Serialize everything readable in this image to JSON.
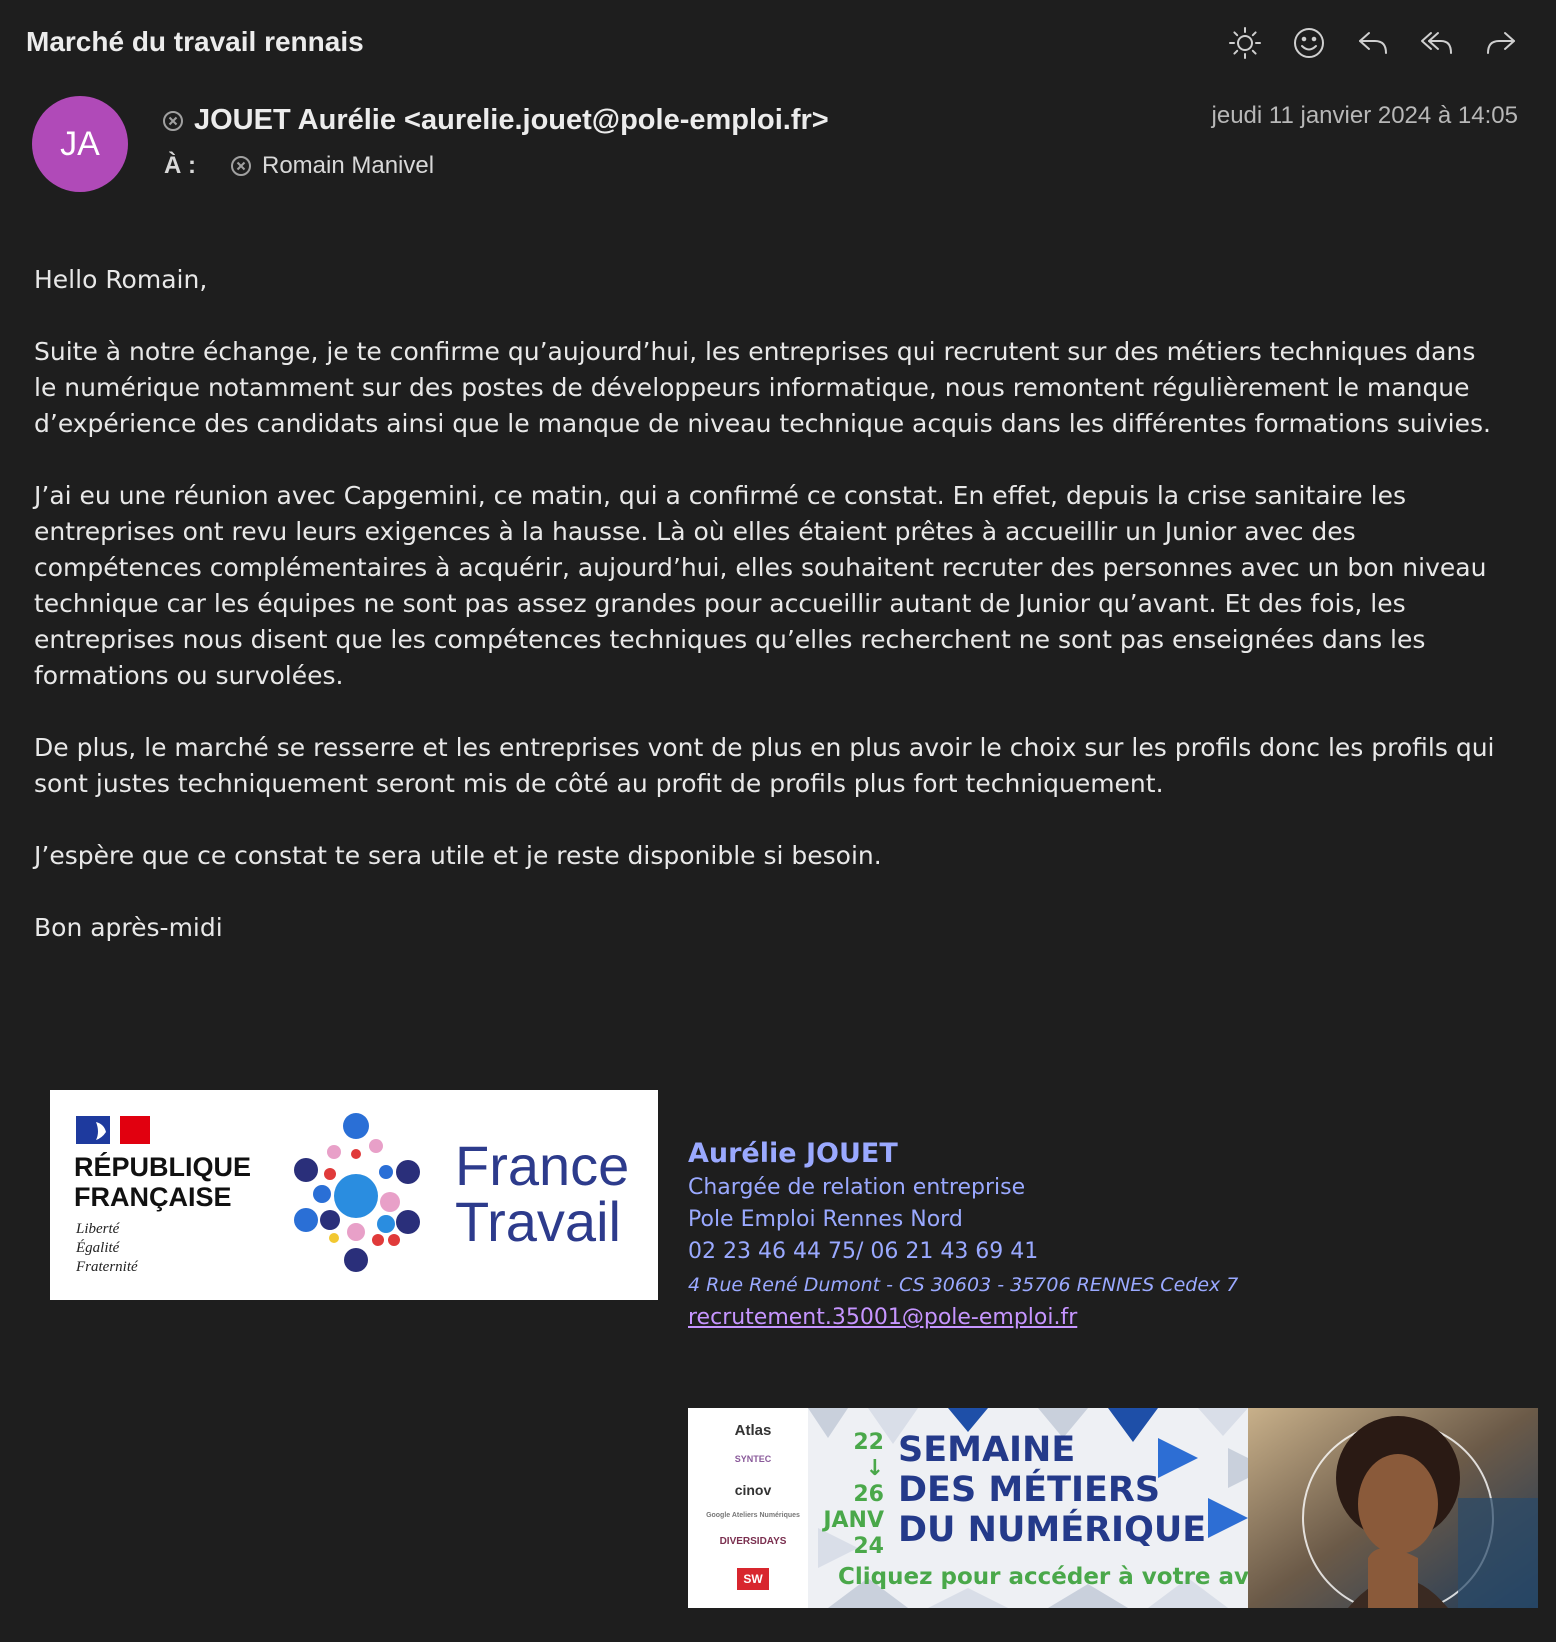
{
  "header": {
    "subject": "Marché du travail rennais",
    "toolbar": [
      {
        "name": "appearance-icon"
      },
      {
        "name": "emoji-icon"
      },
      {
        "name": "reply-icon"
      },
      {
        "name": "reply-all-icon"
      },
      {
        "name": "forward-icon"
      }
    ]
  },
  "message": {
    "avatar_initials": "JA",
    "avatar_color": "#b04ab8",
    "from": "JOUET Aurélie <aurelie.jouet@pole-emploi.fr>",
    "to_label": "À :",
    "to": "Romain Manivel",
    "date": "jeudi 11 janvier 2024 à 14:05"
  },
  "body": {
    "greeting": "Hello Romain,",
    "paragraphs": [
      "Suite à notre échange, je te confirme qu’aujourd’hui, les entreprises qui recrutent sur des métiers techniques dans le numérique notamment sur des postes de développeurs informatique, nous remontent régulièrement le manque d’expérience des candidats ainsi que le manque de niveau technique acquis dans les différentes formations suivies.",
      "J’ai eu une réunion avec Capgemini, ce matin, qui a confirmé ce constat. En effet, depuis la crise sanitaire les entreprises ont revu leurs exigences à la hausse. Là où elles étaient prêtes à accueillir un Junior avec des compétences complémentaires à acquérir, aujourd’hui, elles souhaitent recruter des personnes avec un bon niveau technique car les équipes ne sont pas assez grandes pour accueillir autant de Junior qu’avant. Et des fois, les entreprises nous disent que les compétences techniques qu’elles recherchent ne sont pas enseignées dans les formations ou survolées.",
      "De plus, le marché se resserre et les entreprises vont de plus en plus avoir le choix sur les profils donc les profils qui sont justes techniquement seront mis de côté au profit de profils plus fort techniquement.",
      "J’espère que ce constat te sera utile et je reste disponible si besoin.",
      "Bon après-midi"
    ]
  },
  "logo": {
    "rf_line1": "RÉPUBLIQUE",
    "rf_line2": "FRANÇAISE",
    "motto": [
      "Liberté",
      "Égalité",
      "Fraternité"
    ],
    "ft_line1": "France",
    "ft_line2": "Travail"
  },
  "signature": {
    "name": "Aurélie JOUET",
    "role": "Chargée de relation entreprise",
    "agency": "Pole Emploi Rennes Nord",
    "phones": "02 23 46 44 75/ 06 21 43 69 41",
    "address": "4 Rue René Dumont - CS 30603 - 35706 RENNES Cedex 7",
    "email": "recrutement.35001@pole-emploi.fr",
    "color": "#9aa9ff"
  },
  "banner": {
    "partners": [
      "Atlas",
      "SYNTEC",
      "cinov",
      "Google Ateliers Numériques",
      "DIVERSIDAYS",
      "SW"
    ],
    "dates": [
      "22",
      "↓",
      "26",
      "JANV",
      "24"
    ],
    "title_lines": [
      "SEMAINE",
      "DES MÉTIERS",
      "DU NUMÉRIQUE"
    ],
    "cta": "Cliquez pour accéder à votre avenir"
  }
}
